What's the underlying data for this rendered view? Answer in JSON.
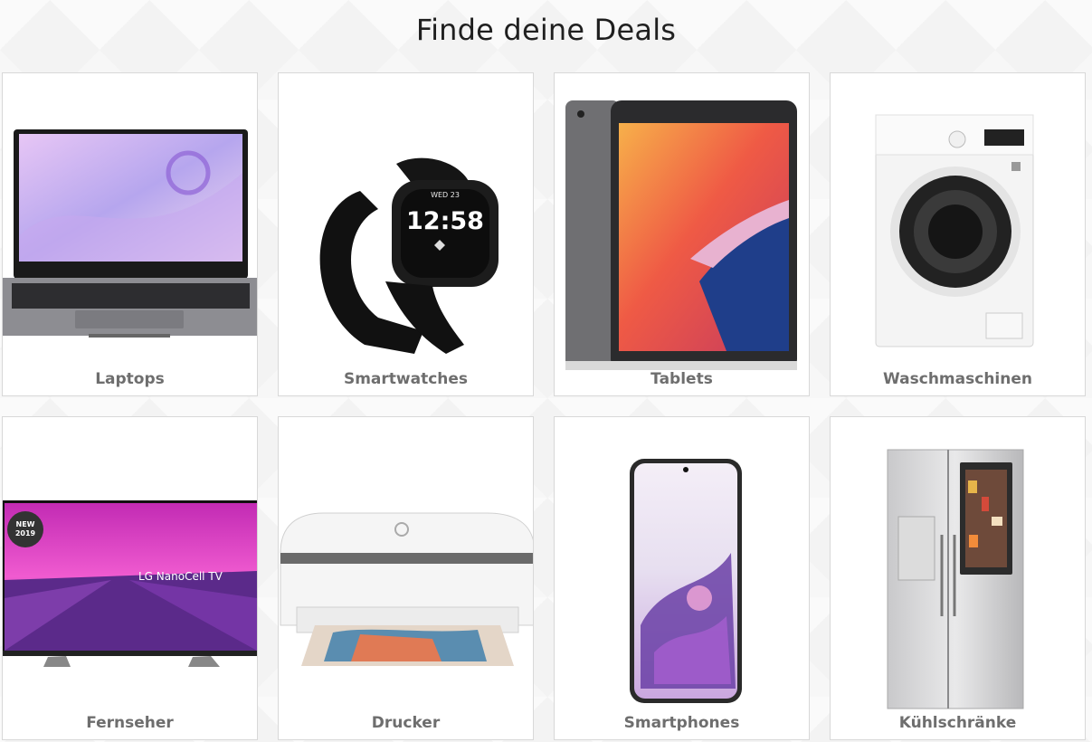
{
  "page": {
    "title": "Finde deine Deals"
  },
  "categories": [
    {
      "label": "Laptops",
      "icon": "laptop-image"
    },
    {
      "label": "Smartwatches",
      "icon": "smartwatch-image",
      "watch_date": "WED 23",
      "watch_time": "12:58"
    },
    {
      "label": "Tablets",
      "icon": "tablet-image"
    },
    {
      "label": "Waschmaschinen",
      "icon": "washing-machine-image"
    },
    {
      "label": "Fernseher",
      "icon": "tv-image",
      "tv_badge": [
        "NEW",
        "2019"
      ],
      "tv_brand": "LG NanoCell TV"
    },
    {
      "label": "Drucker",
      "icon": "printer-image"
    },
    {
      "label": "Smartphones",
      "icon": "smartphone-image"
    },
    {
      "label": "Kühlschränke",
      "icon": "fridge-image"
    }
  ]
}
